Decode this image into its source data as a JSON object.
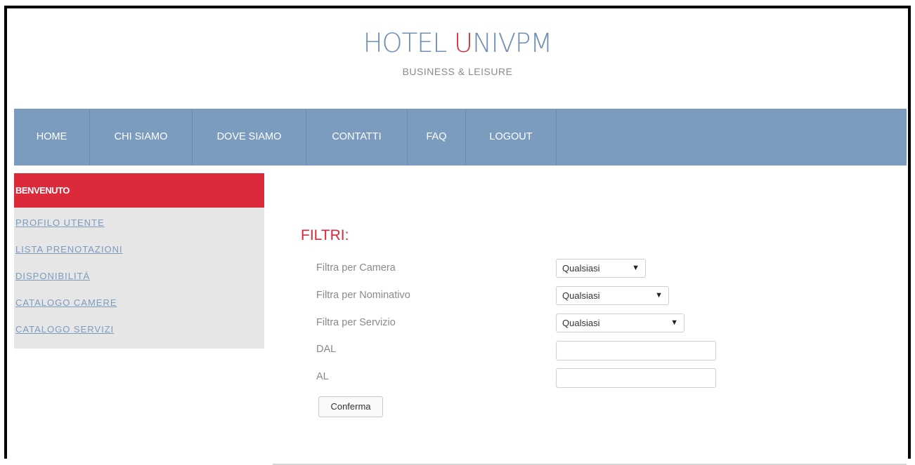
{
  "brand": {
    "title_pre": "HOTEL ",
    "title_u": "U",
    "title_post": "NIVPM",
    "subtitle": "BUSINESS & LEISURE",
    "accent_color": "#d92a3a",
    "title_color": "#6f8fb5"
  },
  "nav": {
    "items": [
      {
        "label": "HOME"
      },
      {
        "label": "CHI SIAMO"
      },
      {
        "label": "DOVE SIAMO"
      },
      {
        "label": "CONTATTI"
      },
      {
        "label": "FAQ"
      },
      {
        "label": "LOGOUT"
      }
    ],
    "background": "#7b9bbf"
  },
  "sidebar": {
    "header": "BENVENUTO",
    "header_color": "#dd2a3b",
    "links": [
      {
        "label": "PROFILO UTENTE"
      },
      {
        "label": "LISTA PRENOTAZIONI"
      },
      {
        "label": "DISPONIBILITÁ"
      },
      {
        "label": "CATALOGO CAMERE"
      },
      {
        "label": "CATALOGO SERVIZI"
      }
    ]
  },
  "filters": {
    "title": "FILTRI:",
    "camera": {
      "label": "Filtra per Camera",
      "value": "Qualsiasi",
      "icon": "dropdown-arrow-icon"
    },
    "nominativo": {
      "label": "Filtra per Nominativo",
      "value": "Qualsiasi",
      "icon": "dropdown-arrow-icon"
    },
    "servizio": {
      "label": "Filtra per Servizio",
      "value": "Qualsiasi",
      "icon": "dropdown-arrow-icon"
    },
    "dal": {
      "label": "DAL",
      "value": ""
    },
    "al": {
      "label": "AL",
      "value": ""
    },
    "confirm_label": "Conferma"
  }
}
